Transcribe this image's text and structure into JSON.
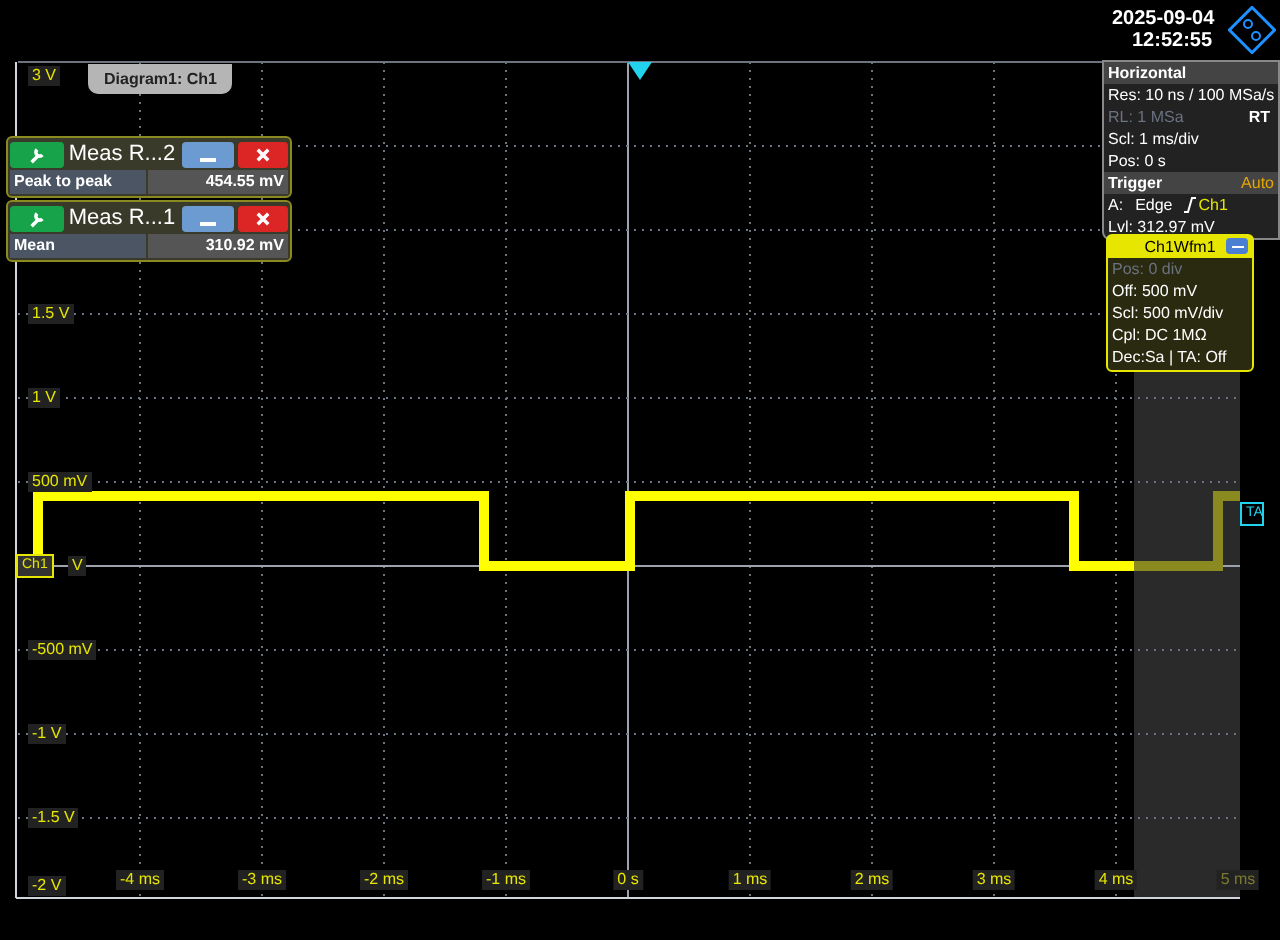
{
  "header": {
    "date": "2025-09-04",
    "time": "12:52:55"
  },
  "diagram": {
    "tab": "Diagram1: Ch1",
    "top_label": "3 V"
  },
  "y_labels": [
    {
      "text": "1.5 V"
    },
    {
      "text": "1 V"
    },
    {
      "text": "500 mV"
    },
    {
      "text": "V"
    },
    {
      "text": "-500 mV"
    },
    {
      "text": "-1 V"
    },
    {
      "text": "-1.5 V"
    },
    {
      "text": "-2 V"
    }
  ],
  "x_labels": [
    {
      "text": "-4 ms",
      "disabled": false
    },
    {
      "text": "-3 ms",
      "disabled": false
    },
    {
      "text": "-2 ms",
      "disabled": false
    },
    {
      "text": "-1 ms",
      "disabled": false
    },
    {
      "text": "0 s",
      "disabled": false
    },
    {
      "text": "1 ms",
      "disabled": false
    },
    {
      "text": "2 ms",
      "disabled": false
    },
    {
      "text": "3 ms",
      "disabled": false
    },
    {
      "text": "4 ms",
      "disabled": false
    },
    {
      "text": "5 ms",
      "disabled": true
    }
  ],
  "measurements": [
    {
      "title": "Meas R...2",
      "label": "Peak to peak",
      "value": "454.55 mV"
    },
    {
      "title": "Meas R...1",
      "label": "Mean",
      "value": "310.92 mV"
    }
  ],
  "horizontal": {
    "title": "Horizontal",
    "lines": [
      {
        "text": "Res: 10 ns / 100 MSa/s",
        "disabled": false
      },
      {
        "text": "RL: 1 MSa",
        "disabled": true,
        "badge": "RT"
      },
      {
        "text": "Scl: 1 ms/div",
        "disabled": false
      },
      {
        "text": "Pos: 0 s",
        "disabled": false
      }
    ]
  },
  "trigger": {
    "title": "Trigger",
    "mode": "Auto",
    "slot": "A:",
    "type": "Edge",
    "source": "Ch1",
    "lines": [
      "Lvl: 312.97 mV"
    ]
  },
  "channel_panel": {
    "title": "Ch1Wfm1",
    "lines": [
      {
        "text": "Pos: 0 div",
        "disabled": true
      },
      {
        "text": "Off: 500 mV",
        "disabled": false
      },
      {
        "text": "Scl: 500 mV/div",
        "disabled": false
      },
      {
        "text": "Cpl: DC 1MΩ",
        "disabled": false
      },
      {
        "text": "Dec:Sa | TA: Off",
        "disabled": false
      }
    ]
  },
  "markers": {
    "channel": "Ch1",
    "trigger_axis": "TA"
  }
}
